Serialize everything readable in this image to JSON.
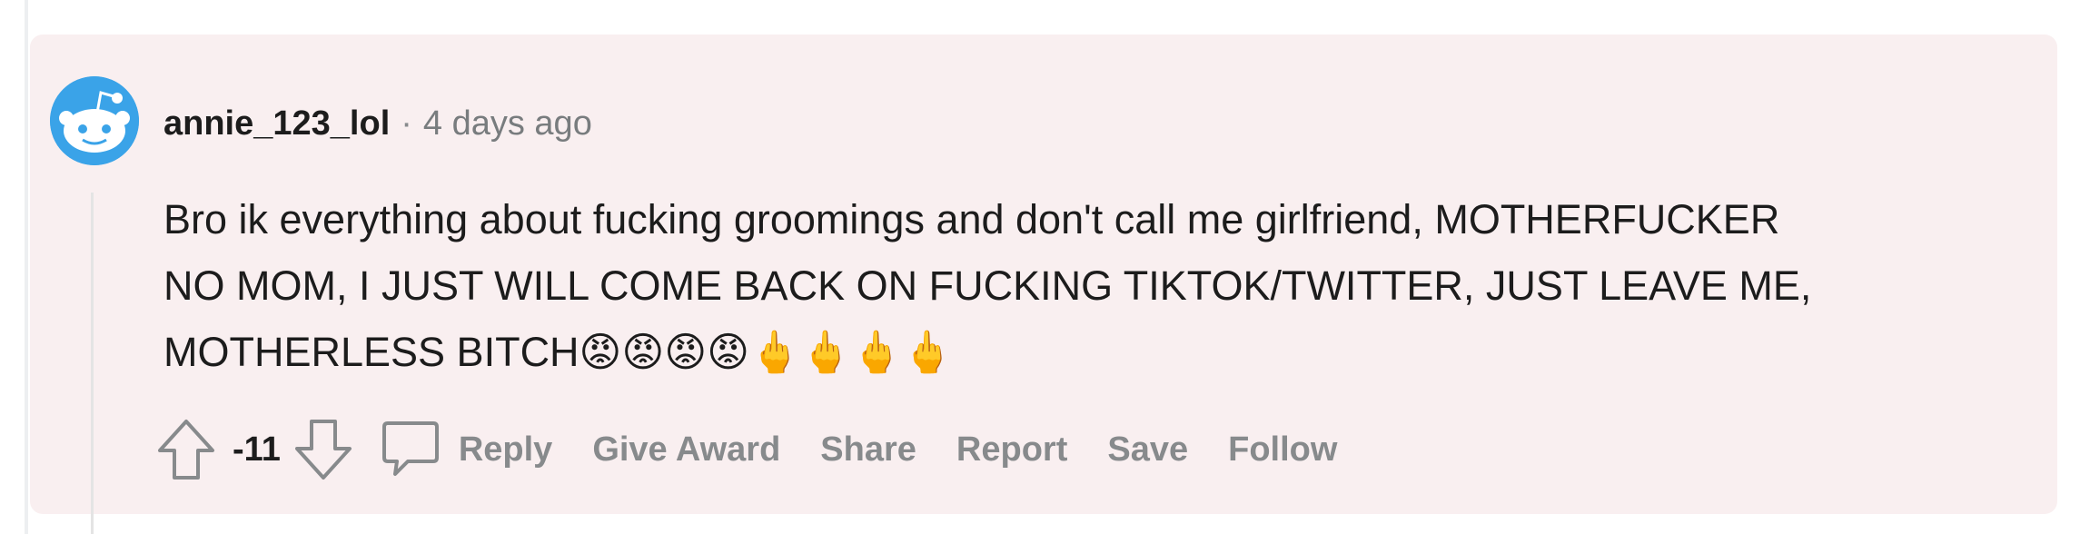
{
  "comment": {
    "author": "annie_123_lol",
    "separator": "·",
    "timestamp": "4 days ago",
    "body_lines": [
      "Bro ik everything about fucking groomings and don't call me girlfriend, MOTHERFUCKER",
      "NO MOM, I JUST WILL COME BACK ON FUCKING TIKTOK/TWITTER, JUST LEAVE ME,",
      "MOTHERLESS BITCH😡😡😡😡🖕🖕🖕🖕"
    ],
    "score": "-11"
  },
  "actions": {
    "reply": "Reply",
    "give_award": "Give Award",
    "share": "Share",
    "report": "Report",
    "save": "Save",
    "follow": "Follow"
  },
  "icons": {
    "upvote": "upvote-arrow-icon",
    "downvote": "downvote-arrow-icon",
    "reply": "speech-bubble-icon",
    "avatar": "snoo-avatar"
  },
  "colors": {
    "card_background": "#f9eff0",
    "avatar_blue": "#3aa3e8",
    "muted_text": "#878a8c",
    "main_text": "#1c1c1c"
  }
}
